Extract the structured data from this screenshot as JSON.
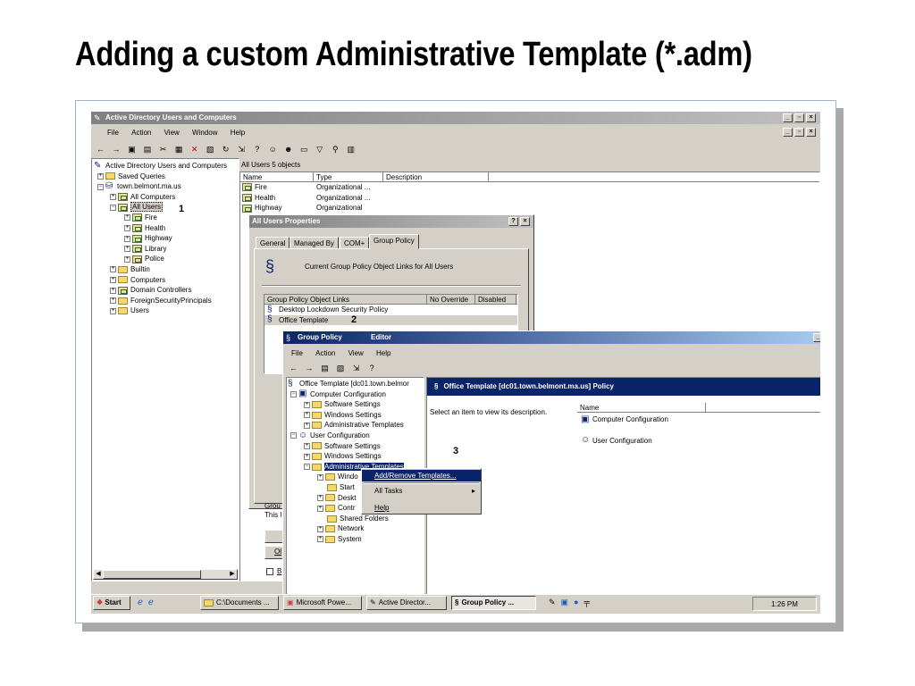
{
  "slide_title": "Adding a custom Administrative Template (*.adm)",
  "aduc": {
    "title": "Active Directory Users and Computers",
    "menu": [
      "File",
      "Action",
      "View",
      "Window",
      "Help"
    ],
    "tree_root": "Active Directory Users and Computers",
    "tree": {
      "saved_queries": "Saved Queries",
      "domain": "town.belmont.ma.us",
      "all_computers": "All Computers",
      "all_users": "All Users",
      "fire": "Fire",
      "health": "Health",
      "highway": "Highway",
      "library": "Library",
      "police": "Police",
      "builtin": "Builtin",
      "computers": "Computers",
      "domain_controllers": "Domain Controllers",
      "fsp": "ForeignSecurityPrincipals",
      "users": "Users"
    },
    "list_header": "All Users   5 objects",
    "columns": [
      "Name",
      "Type",
      "Description"
    ],
    "rows": [
      {
        "name": "Fire",
        "type": "Organizational ..."
      },
      {
        "name": "Health",
        "type": "Organizational ..."
      },
      {
        "name": "Highway",
        "type": "Organizational"
      }
    ]
  },
  "props": {
    "title": "All Users Properties",
    "help_btn": "?",
    "close_btn": "×",
    "tabs": [
      "General",
      "Managed By",
      "COM+",
      "Group Policy"
    ],
    "current_links": "Current Group Policy Object Links for All Users",
    "cols": [
      "Group Policy Object Links",
      "No Override",
      "Disabled"
    ],
    "links": [
      "Desktop Lockdown Security Policy",
      "Office Template"
    ],
    "partial_text_1": "Grou",
    "partial_text_2": "This l",
    "partial_btn": "Ol",
    "partial_check": "B"
  },
  "gpe": {
    "title_left": "Group Policy ",
    "title_right": "Editor",
    "menu": [
      "File",
      "Action",
      "View",
      "Help"
    ],
    "tree_root": "Office Template [dc01.town.belmor",
    "tree": {
      "computer_config": "Computer Configuration",
      "software_settings": "Software Settings",
      "windows_settings": "Windows Settings",
      "admin_templates": "Administrative Templates",
      "user_config": "User Configuration",
      "u_software_settings": "Software Settings",
      "u_windows_settings": "Windows Settings",
      "u_admin_templates": "Administrative Templates",
      "windo": "Windo",
      "start": "Start",
      "deskt": "Deskt",
      "contr": "Contr",
      "shared_folders": "Shared Folders",
      "network": "Network",
      "system": "System"
    },
    "right_title": "Office Template [dc01.town.belmont.ma.us] Policy",
    "description": "Select an item to view its description.",
    "name_col": "Name",
    "items": [
      "Computer Configuration",
      "User Configuration"
    ]
  },
  "context_menu": {
    "items": [
      "Add/Remove Templates...",
      "All Tasks",
      "Help"
    ]
  },
  "callouts": [
    "1",
    "2",
    "3"
  ],
  "taskbar": {
    "start": "Start",
    "items": [
      "C:\\Documents ...",
      "Microsoft Powe...",
      "Active Director...",
      "Group Policy ..."
    ],
    "clock": "1:26 PM"
  },
  "colors": {
    "titlebar_active": "#0a246a",
    "selection": "#0a246a",
    "face": "#d4d0c8"
  }
}
